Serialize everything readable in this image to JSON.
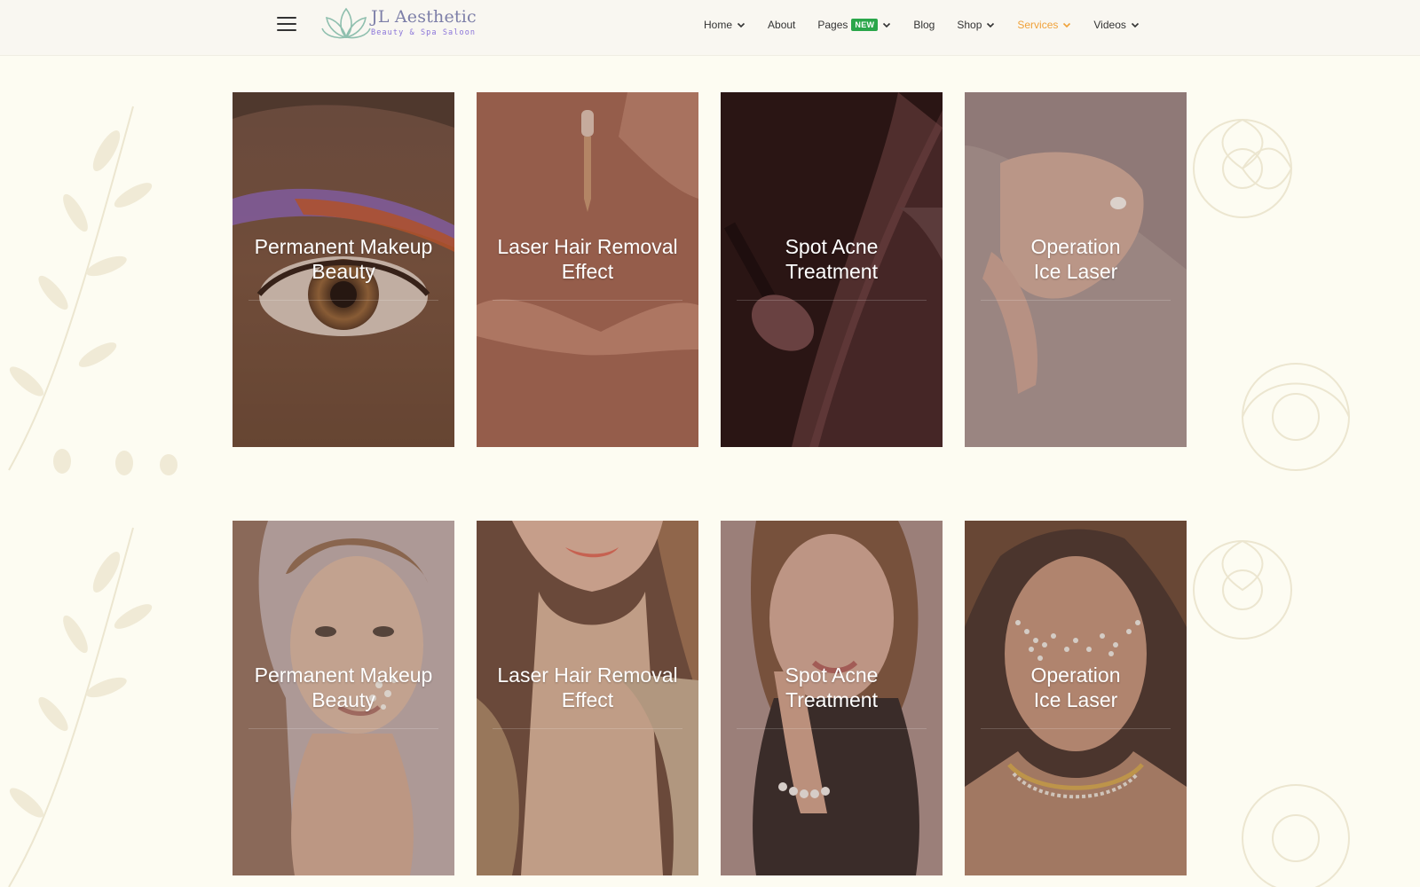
{
  "header": {
    "logo": {
      "title": "JL Aesthetic",
      "subtitle": "Beauty & Spa Saloon"
    },
    "nav": [
      {
        "label": "Home",
        "dropdown": true,
        "active": false
      },
      {
        "label": "About",
        "dropdown": false,
        "active": false
      },
      {
        "label": "Pages",
        "dropdown": true,
        "badge": "NEW",
        "active": false
      },
      {
        "label": "Blog",
        "dropdown": false,
        "active": false
      },
      {
        "label": "Shop",
        "dropdown": true,
        "active": false
      },
      {
        "label": "Services",
        "dropdown": true,
        "active": true
      },
      {
        "label": "Videos",
        "dropdown": true,
        "active": false
      }
    ],
    "accent_color": "#f0a23a",
    "badge_color": "#2aa64a"
  },
  "services_row_1": [
    {
      "title": "Permanent Makeup\nBeauty",
      "image": "eye-makeup"
    },
    {
      "title": "Laser Hair Removal\nEffect",
      "image": "serum-dropper-hands"
    },
    {
      "title": "Spot Acne\nTreatment",
      "image": "makeup-brush-powder"
    },
    {
      "title": "Operation\nIce Laser",
      "image": "hands-cream"
    }
  ],
  "services_row_2": [
    {
      "title": "Permanent Makeup\nBeauty",
      "image": "woman-with-flowers"
    },
    {
      "title": "Laser Hair Removal\nEffect",
      "image": "woman-hand-neck"
    },
    {
      "title": "Spot Acne\nTreatment",
      "image": "woman-bracelet"
    },
    {
      "title": "Operation\nIce Laser",
      "image": "woman-pearls-face"
    }
  ]
}
